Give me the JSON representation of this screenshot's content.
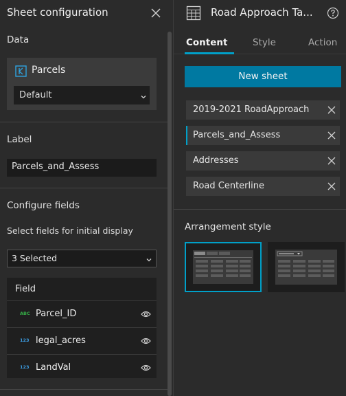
{
  "left_panel": {
    "title": "Sheet configuration",
    "data_section": {
      "label": "Data",
      "source_name": "Parcels",
      "view_value": "Default"
    },
    "label_section": {
      "label": "Label",
      "value": "Parcels_and_Assess"
    },
    "fields_section": {
      "label": "Configure fields",
      "hint": "Select fields for initial display",
      "selected_text": "3 Selected",
      "table_header": "Field",
      "fields": [
        {
          "type": "ABC",
          "name": "Parcel_ID",
          "type_color": "#35ac46"
        },
        {
          "type": "123",
          "name": "legal_acres",
          "type_color": "#3b9be0"
        },
        {
          "type": "123",
          "name": "LandVal",
          "type_color": "#3b9be0"
        }
      ]
    }
  },
  "right_panel": {
    "title": "Road Approach Ta...",
    "tabs": [
      {
        "label": "Content",
        "active": true
      },
      {
        "label": "Style",
        "active": false
      },
      {
        "label": "Action",
        "active": false
      }
    ],
    "new_sheet_label": "New sheet",
    "sheets": [
      {
        "label": "2019-2021 RoadApproach",
        "active": false
      },
      {
        "label": "Parcels_and_Assess",
        "active": true
      },
      {
        "label": "Addresses",
        "active": false
      },
      {
        "label": "Road Centerline",
        "active": false
      }
    ],
    "arrangement": {
      "label": "Arrangement style",
      "selected_index": 0
    }
  },
  "colors": {
    "accent": "#00a0c8",
    "button": "#0079a1",
    "panel": "#2b2b2b"
  }
}
